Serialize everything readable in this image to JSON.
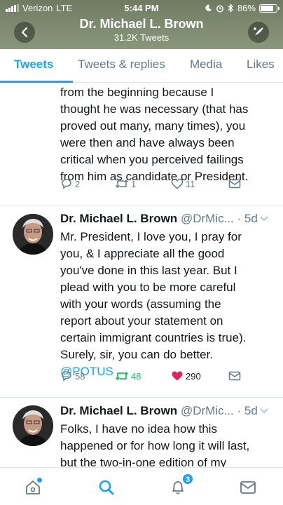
{
  "status_bar": {
    "carrier": "Verizon",
    "network": "LTE",
    "time": "5:44 PM",
    "battery": "86%"
  },
  "header": {
    "title": "Dr. Michael L. Brown",
    "subtitle": "31.2K Tweets",
    "back_icon": "chevron-left-icon",
    "compose_icon": "compose-tweet-icon"
  },
  "tabs": [
    {
      "label": "Tweets",
      "active": true
    },
    {
      "label": "Tweets & replies",
      "active": false
    },
    {
      "label": "Media",
      "active": false
    },
    {
      "label": "Likes",
      "active": false
    }
  ],
  "tweets": [
    {
      "lines": [
        "from the beginning because I",
        "thought he was necessary (that has",
        "proved out many, many times), you",
        "were then and have always been",
        "critical when you perceived failings",
        "from him as candidate or President."
      ],
      "replies": "2",
      "retweets": "1",
      "likes": "11"
    },
    {
      "name": "Dr. Michael L. Brown",
      "handle": "@DrMic...",
      "time": "· 5d",
      "lines": [
        "Mr. President, I love you, I pray for",
        "you, & I appreciate all the good",
        "you've done in this last year. But I",
        "plead with you to be more careful",
        "with your words (assuming the",
        "report about your statement on",
        "certain immigrant countries is true).",
        "Surely, sir, you can do better."
      ],
      "mention": "@POTUS",
      "replies": "58",
      "retweets": "48",
      "likes": "290"
    },
    {
      "name": "Dr. Michael L. Brown",
      "handle": "@DrMic...",
      "time": "· 5d",
      "lines": [
        "Folks, I have no idea how this",
        "happened or for how long it will last,",
        "but the two-in-one edition of my"
      ]
    }
  ],
  "bottom_nav": {
    "items": [
      {
        "icon": "home-icon"
      },
      {
        "icon": "search-icon"
      },
      {
        "icon": "notifications-icon",
        "badge": "3"
      },
      {
        "icon": "messages-icon"
      }
    ]
  },
  "colors": {
    "accent": "#1da1f2",
    "retweeted": "#17bf63",
    "liked": "#e0245e",
    "header_bg": "#7e8a70"
  }
}
